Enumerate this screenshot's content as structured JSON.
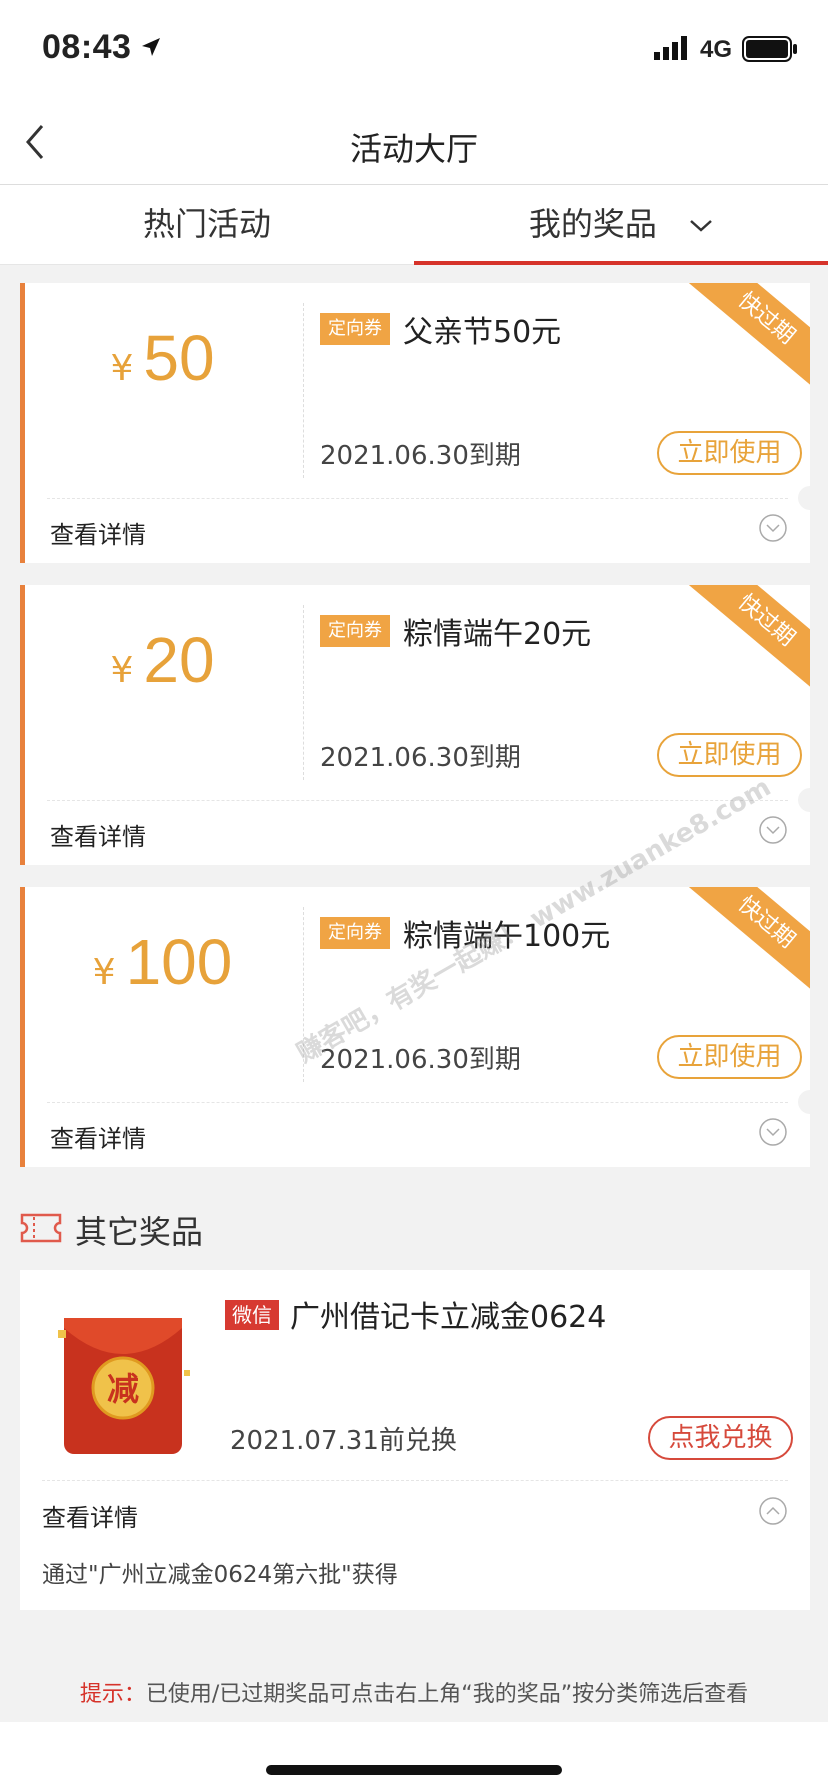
{
  "status_bar": {
    "time": "08:43",
    "network": "4G",
    "icons": [
      "location-arrow-icon",
      "signal-icon",
      "battery-icon"
    ]
  },
  "nav": {
    "title": "活动大厅",
    "back_icon": "chevron-left-icon"
  },
  "tabs": [
    {
      "label": "热门活动",
      "active": false
    },
    {
      "label": "我的奖品",
      "active": true
    }
  ],
  "coupons": [
    {
      "currency": "¥",
      "amount": "50",
      "tag": "定向券",
      "title": "父亲节50元",
      "expire": "2021.06.30到期",
      "button": "立即使用",
      "details": "查看详情",
      "ribbon": "快过期"
    },
    {
      "currency": "¥",
      "amount": "20",
      "tag": "定向券",
      "title": "粽情端午20元",
      "expire": "2021.06.30到期",
      "button": "立即使用",
      "details": "查看详情",
      "ribbon": "快过期"
    },
    {
      "currency": "¥",
      "amount": "100",
      "tag": "定向券",
      "title": "粽情端午100元",
      "expire": "2021.06.30到期",
      "button": "立即使用",
      "details": "查看详情",
      "ribbon": "快过期"
    }
  ],
  "other_prizes": {
    "section_title": "其它奖品",
    "item": {
      "image_char": "减",
      "tag": "微信",
      "title": "广州借记卡立减金0624",
      "expire": "2021.07.31前兑换",
      "button": "点我兑换",
      "details": "查看详情",
      "source": "通过\"广州立减金0624第六批\"获得"
    }
  },
  "tip": {
    "label": "提示：",
    "text": "已使用/已过期奖品可点击右上角“我的奖品”按分类筛选后查看"
  },
  "watermark": "赚客吧，有奖一起赚！ www.zuanke8.com",
  "colors": {
    "accent_orange": "#e7a23a",
    "ribbon_orange": "#f0a444",
    "red": "#d6332a"
  }
}
